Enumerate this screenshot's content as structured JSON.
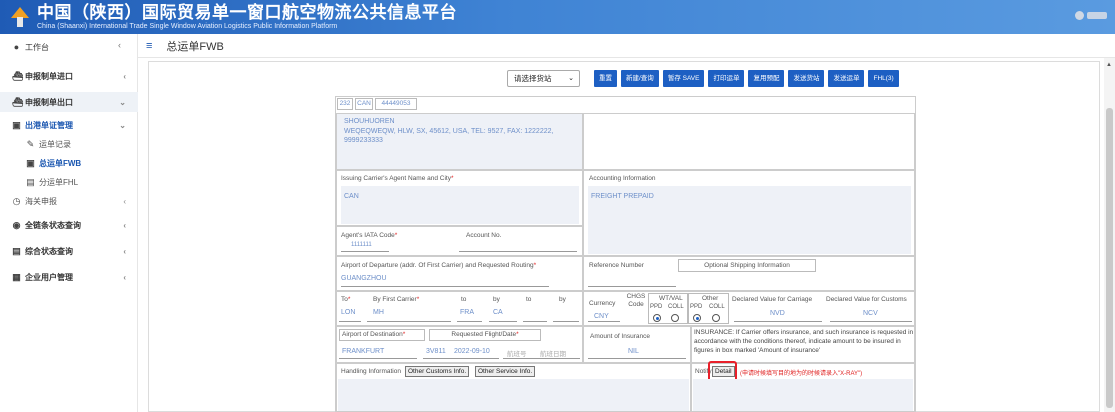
{
  "header": {
    "title": "中国（陕西）国际贸易单一窗口航空物流公共信息平台",
    "subtitle": "China (Shaanxi) International Trade Single Window Aviation Logistics Public Information Platform"
  },
  "topbar": {
    "home": "工作台",
    "page_title": "总运单FWB"
  },
  "sidebar": {
    "items": [
      {
        "label": "申报制单进口"
      },
      {
        "label": "申报制单出口"
      },
      {
        "label": "出港单证管理"
      },
      {
        "label": "运单记录"
      },
      {
        "label": "总运单FWB"
      },
      {
        "label": "分运单FHL"
      },
      {
        "label": "海关申报"
      },
      {
        "label": "全链条状态查询"
      },
      {
        "label": "综合状态查询"
      },
      {
        "label": "企业用户管理"
      }
    ]
  },
  "toolbar": {
    "select_value": "请选择货站",
    "buttons": [
      "重置",
      "新建/查询",
      "暂存 SAVE",
      "打印运单",
      "复用预配",
      "发送货站",
      "发送运单",
      "FHL(3)"
    ]
  },
  "form": {
    "awb_prefix": "232",
    "awb_airport": "CAN",
    "awb_number": "44449053",
    "shipper_name": "SHOUHUOREN",
    "shipper_address": "WEQEQWEQW, HLW, SX, 45612, USA, TEL: 9527, FAX: 1222222, 9999233333",
    "agent_name_label": "Issuing Carrier's Agent Name and City",
    "agent_name_value": "CAN",
    "accounting_label": "Accounting Information",
    "accounting_value": "FREIGHT PREPAID",
    "iata_code_label": "Agent's IATA Code",
    "iata_code_value": "1111111",
    "account_no_label": "Account No.",
    "departure_label": "Airport of Departure (addr. Of First Carrier) and Requested Routing",
    "departure_value": "GUANGZHOU",
    "reference_label": "Reference Number",
    "optional_label": "Optional Shipping Information",
    "to_label": "To",
    "by_first_label": "By First Carrier",
    "to2_label": "to",
    "by2_label": "by",
    "to3_label": "to",
    "by3_label": "by",
    "to_value": "LON",
    "by_first_value": "MH",
    "to2_value": "FRA",
    "by2_value": "CA",
    "currency_label": "Currency",
    "currency_value": "CNY",
    "chgs_label": "CHGS Code",
    "wtval_label": "WT/VAL",
    "other_label": "Other",
    "ppd_label": "PPD",
    "coll_label": "COLL",
    "carriage_label": "Declared Value for Carriage",
    "carriage_value": "NVD",
    "customs_label": "Declared Value for Customs",
    "customs_value": "NCV",
    "destination_label": "Airport of Destination",
    "destination_value": "FRANKFURT",
    "flight_label": "Requested Flight/Date",
    "flight_value": "3V811",
    "flight_date": "2022-09-10",
    "flight2_ph": "航班号",
    "flight2_date_ph": "航班日期",
    "insurance_label": "Amount of Insurance",
    "insurance_value": "NIL",
    "insurance_note": "INSURANCE: If Carrier offers insurance, and such insurance is requested in accordance with the conditions thereof, indicate amount to be insured in figures in box marked 'Amount of insurance'",
    "handling_label": "Handling Information",
    "other_customs_btn": "Other Customs Info.",
    "other_service_btn": "Other Service Info.",
    "notify_label": "Notify",
    "detail_btn": "Detail",
    "detail_hint": "(申请时候填写目的地为的时候请录入\"X-RAY\")"
  }
}
